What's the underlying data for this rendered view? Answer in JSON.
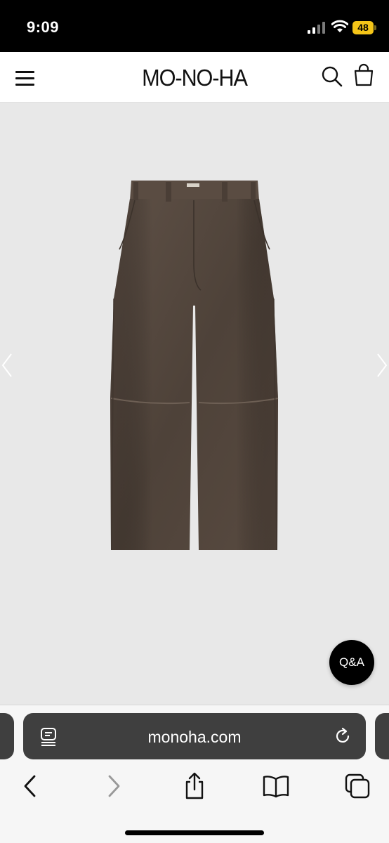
{
  "status_bar": {
    "time": "9:09",
    "battery_level": "48",
    "battery_color": "#f5c518"
  },
  "header": {
    "logo": "MO-NO-HA",
    "menu_icon": "hamburger-menu-icon",
    "search_icon": "search-icon",
    "cart_icon": "shopping-bag-icon"
  },
  "gallery": {
    "image": "brown-suede-trousers",
    "prev_icon": "chevron-left-icon",
    "next_icon": "chevron-right-icon",
    "qa_label": "Q&A",
    "background_color": "#e8e8e8"
  },
  "browser": {
    "url": "monoha.com",
    "reader_icon": "reader-mode-icon",
    "reload_icon": "reload-icon",
    "toolbar": [
      "back-icon",
      "forward-icon",
      "share-icon",
      "bookmarks-icon",
      "tabs-icon"
    ]
  }
}
